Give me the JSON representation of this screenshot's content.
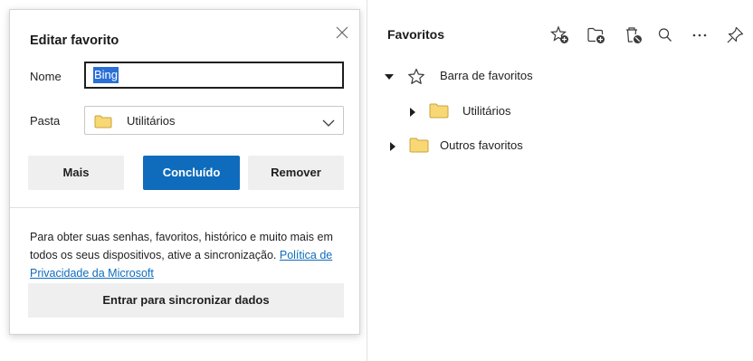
{
  "edit_dialog": {
    "title": "Editar favorito",
    "name_label": "Nome",
    "name_value": "Bing",
    "folder_label": "Pasta",
    "folder_value": "Utilitários",
    "buttons": {
      "more": "Mais",
      "done": "Concluído",
      "remove": "Remover"
    },
    "sync_text": "Para obter suas senhas, favoritos, histórico e muito mais em todos os seus dispositivos, ative a sincronização.",
    "privacy_link": "Política de Privacidade da Microsoft",
    "sync_button": "Entrar para sincronizar dados",
    "accent_color": "#0f6cbd"
  },
  "favorites_panel": {
    "title": "Favoritos",
    "toolbar_icons": [
      "add-favorite-icon",
      "add-folder-icon",
      "delete-favorite-icon",
      "search-icon",
      "more-icon",
      "pin-icon"
    ],
    "tree": [
      {
        "label": "Barra de favoritos",
        "icon": "star-outline-icon",
        "expanded": true
      },
      {
        "label": "Utilitários",
        "icon": "folder-icon",
        "expanded": false
      },
      {
        "label": "Outros favoritos",
        "icon": "folder-icon",
        "expanded": false
      }
    ],
    "folder_color": "#f8d775"
  }
}
